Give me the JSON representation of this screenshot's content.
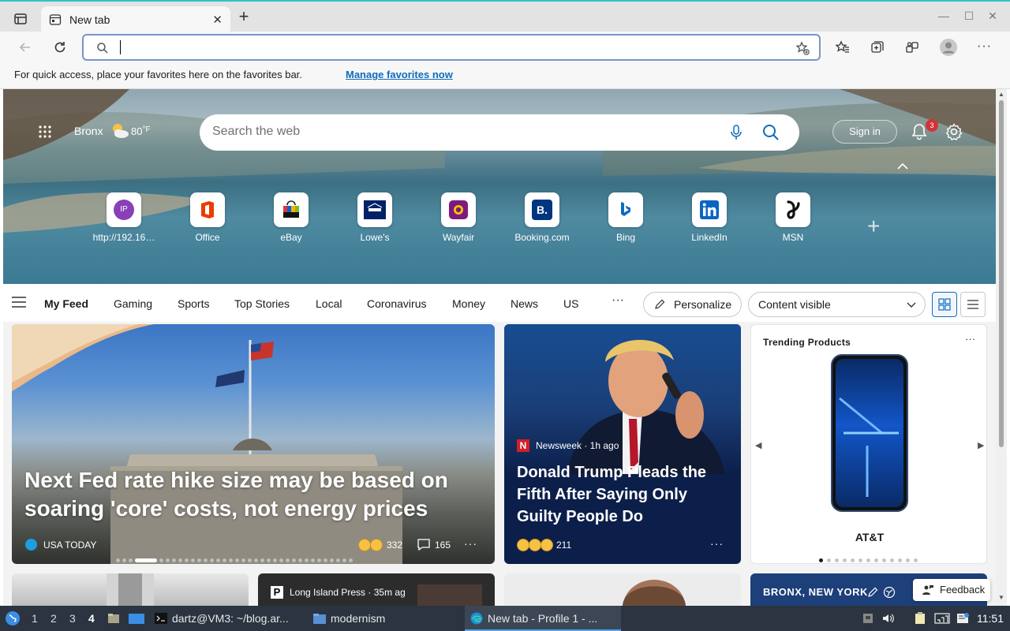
{
  "browser": {
    "tab_title": "New tab",
    "favorites_message": "For quick access, place your favorites here on the favorites bar.",
    "favorites_link": "Manage favorites now",
    "address_value": ""
  },
  "hero": {
    "location": "Bronx",
    "temperature": "80",
    "temp_unit": "°F",
    "search_placeholder": "Search the web",
    "sign_in": "Sign in",
    "notification_count": "3",
    "quick_links": [
      {
        "label": "http://192.16…",
        "icon": "ip-icon"
      },
      {
        "label": "Office",
        "icon": "office-icon"
      },
      {
        "label": "eBay",
        "icon": "ebay-icon"
      },
      {
        "label": "Lowe's",
        "icon": "lowes-icon"
      },
      {
        "label": "Wayfair",
        "icon": "wayfair-icon"
      },
      {
        "label": "Booking.com",
        "icon": "booking-icon"
      },
      {
        "label": "Bing",
        "icon": "bing-icon"
      },
      {
        "label": "LinkedIn",
        "icon": "linkedin-icon"
      },
      {
        "label": "MSN",
        "icon": "msn-icon"
      }
    ],
    "ip_tile_text": "IP",
    "booking_tile_text": "B."
  },
  "feed_nav": {
    "items": [
      "My Feed",
      "Gaming",
      "Sports",
      "Top Stories",
      "Local",
      "Coronavirus",
      "Money",
      "News",
      "US"
    ],
    "more": "···",
    "personalize": "Personalize",
    "content_select": "Content visible"
  },
  "cards": {
    "main": {
      "headline": "Next Fed rate hike size may be based on soaring 'core' costs, not energy prices",
      "source": "USA TODAY",
      "reactions": "332",
      "comments": "165"
    },
    "second": {
      "source": "Newsweek · 1h ago",
      "source_letter": "N",
      "headline": "Donald Trump Pleads the Fifth After Saying Only Guilty People Do",
      "reactions": "211"
    },
    "trending": {
      "title": "Trending Products",
      "brand": "AT&T"
    },
    "row2_source": "Long Island Press · 35m ag",
    "row2_source_letter": "P",
    "row2_location": "BRONX, NEW YORK",
    "feedback": "Feedback"
  },
  "taskbar": {
    "workspaces": [
      "1",
      "2",
      "3",
      "4"
    ],
    "active_workspace": "4",
    "terminal": "dartz@VM3: ~/blog.ar...",
    "folder": "modernism",
    "browser": "New tab - Profile 1 - ...",
    "clock": "11:51"
  },
  "colors": {
    "accent": "#0f6cbd",
    "badge": "#d13438",
    "taskbar": "#2b3440"
  }
}
